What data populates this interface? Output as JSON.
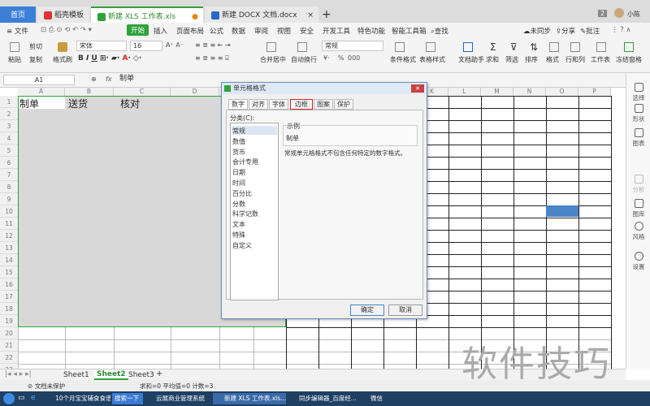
{
  "tabs": {
    "home": "首页",
    "t1": "稻壳模板",
    "t2": "新建 XLS 工作表.xls",
    "t3": "新建 DOCX 文档.docx",
    "plus": "+",
    "badge": "2",
    "user": "小陈"
  },
  "menu": {
    "file": "≡ 文件",
    "start": "开始",
    "items": [
      "插入",
      "页面布局",
      "公式",
      "数据",
      "审阅",
      "视图",
      "安全",
      "开发工具",
      "特色功能",
      "智能工具箱"
    ],
    "search": "查找",
    "sync": "未同步",
    "share": "分享",
    "annot": "批注"
  },
  "ribbon": {
    "paste": "粘贴",
    "cut": "剪切",
    "copy": "复制",
    "format_painter": "格式刷",
    "font": "宋体",
    "size": "16",
    "merge": "合并居中",
    "wrap": "自动换行",
    "numfmt": "常规",
    "cond": "条件格式",
    "table_style": "表格样式",
    "doc_helper": "文档助手",
    "sum": "求和",
    "filter": "筛选",
    "sort": "排序",
    "fmt": "格式",
    "rowcol": "行和列",
    "sheet": "工作表",
    "freeze": "冻结窗格",
    "pct": "%",
    "thou": "000"
  },
  "formula": {
    "cell_ref": "A1",
    "value": "制单"
  },
  "sheet": {
    "columns": [
      "A",
      "B",
      "C",
      "D",
      "E",
      "F",
      "G",
      "H",
      "I",
      "J",
      "K",
      "L",
      "M",
      "N",
      "O",
      "P"
    ],
    "rows": [
      "1",
      "2",
      "3",
      "4",
      "5",
      "6",
      "7",
      "8",
      "9",
      "10",
      "11",
      "12",
      "13",
      "14",
      "15",
      "16",
      "17",
      "18",
      "19",
      "20",
      "21",
      "22",
      "23"
    ],
    "a1": "制单",
    "b1": "送货",
    "c1": "核对"
  },
  "right_panel": [
    "选择",
    "形状",
    "图表",
    "分析",
    "图库",
    "风格",
    "设置"
  ],
  "dialog": {
    "title": "单元格格式",
    "tabs": [
      "数字",
      "对齐",
      "字体",
      "边框",
      "图案",
      "保护"
    ],
    "category_label": "分类(C):",
    "categories": [
      "常规",
      "数值",
      "货币",
      "会计专用",
      "日期",
      "时间",
      "百分比",
      "分数",
      "科学记数",
      "文本",
      "特殊",
      "自定义"
    ],
    "sample_label": "示例",
    "sample_value": "制单",
    "description": "常规单元格格式不包含任何特定的数字格式。",
    "ok": "确定",
    "cancel": "取消"
  },
  "sheettabs": [
    "Sheet1",
    "Sheet2",
    "Sheet3"
  ],
  "status": {
    "protect": "文档未保护",
    "stats": "求和=0  平均值=0  计数=3"
  },
  "taskbar": [
    "10个月宝宝辅食食谱",
    "搜索一下",
    "云展商业管理系统",
    "新建 XLS 工作表.xls...",
    "同步编辑器_百度经...",
    "微信"
  ],
  "watermark": "软件技巧",
  "colors": {
    "accent_green": "#2fa33a",
    "home_blue": "#3b7fd9",
    "selection_blue": "#4a86c8",
    "highlight_red": "#e02020"
  }
}
